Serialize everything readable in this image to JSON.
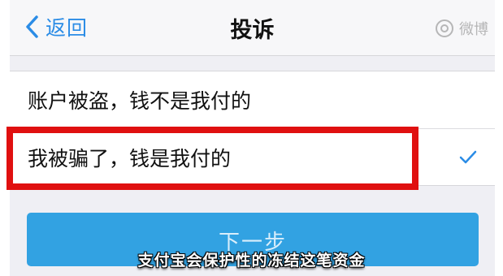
{
  "nav": {
    "back_label": "返回",
    "title": "投诉",
    "watermark": "微博"
  },
  "options": [
    {
      "label": "账户被盗，钱不是我付的",
      "selected": false
    },
    {
      "label": "我被骗了，钱是我付的",
      "selected": true
    }
  ],
  "next_button": {
    "label": "下一步"
  },
  "caption": "支付宝会保护性的冻结这笔资金",
  "colors": {
    "accent": "#2b8ce6",
    "button": "#32a2e2",
    "highlight": "#e01010",
    "background": "#efeff4"
  }
}
